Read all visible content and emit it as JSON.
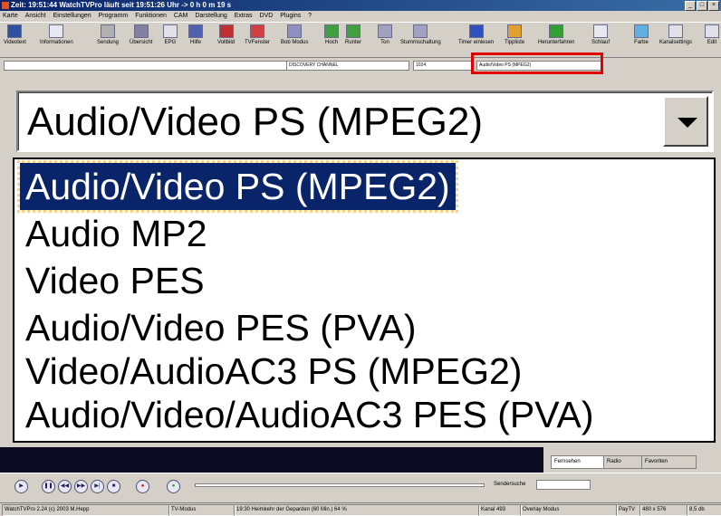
{
  "window": {
    "title": "Zeit: 19:51:44 WatchTVPro läuft seit 19:51:26 Uhr -> 0 h 0 m 19 s",
    "controls": [
      "_",
      "□",
      "×"
    ]
  },
  "menu": [
    "Karte",
    "Ansicht",
    "Einstellungen",
    "Programm",
    "Funktionen",
    "CAM",
    "Darstellung",
    "Extras",
    "DVD",
    "Plugins",
    "?"
  ],
  "toolbar": [
    {
      "label": "Videotext",
      "icon": "videotext-icon"
    },
    {
      "label": "Informationen",
      "icon": "info-icon"
    },
    {
      "label": "Sendung",
      "icon": "program-icon"
    },
    {
      "label": "Übersicht",
      "icon": "overview-icon"
    },
    {
      "label": "EPG",
      "icon": "epg-icon"
    },
    {
      "label": "Hilfe",
      "icon": "help-icon"
    },
    {
      "label": "Vollbild",
      "icon": "fullscreen-icon"
    },
    {
      "label": "TVFenster",
      "icon": "tv-window-icon"
    },
    {
      "label": "Bob Modus",
      "icon": "bob-mode-icon"
    },
    {
      "label": "Hoch",
      "icon": "up-icon"
    },
    {
      "label": "Runter",
      "icon": "down-icon"
    },
    {
      "label": "Ton",
      "icon": "sound-icon"
    },
    {
      "label": "Stummschaltung",
      "icon": "mute-icon"
    },
    {
      "label": "Timer einlesen",
      "icon": "timer-icon"
    },
    {
      "label": "Tippliste",
      "icon": "list-icon"
    },
    {
      "label": "Herunterfahren",
      "icon": "shutdown-icon"
    },
    {
      "label": "Schlauf",
      "icon": "sleep-icon"
    },
    {
      "label": "Farbe",
      "icon": "color-icon"
    },
    {
      "label": "Kanalsettings",
      "icon": "channel-settings-icon"
    },
    {
      "label": "Edit",
      "icon": "edit-icon"
    }
  ],
  "combobar": {
    "channel": "DISCOVERY CHANNEL",
    "code": "1024",
    "format": "Audio/Video PS (MPEG2)"
  },
  "format_select": {
    "selected": "Audio/Video PS (MPEG2)",
    "options": [
      "Audio/Video PS (MPEG2)",
      "Audio MP2",
      "Video PES",
      "Audio/Video PES (PVA)",
      "Video/AudioAC3 PS (MPEG2)",
      "Audio/Video/AudioAC3 PES (PVA)"
    ]
  },
  "tabs": [
    "Fernsehen",
    "Radio",
    "Favoriten"
  ],
  "search": {
    "label": "Sendersuche",
    "value": ""
  },
  "statusbar": [
    "WatchTVPro 2.24 (c) 2003 M.Hepp",
    "TV-Modus",
    "19:30 Heimkehr der Geparden (60 Min.) 64 %",
    "Kanal 493",
    "Overlay Modus",
    "PayTV",
    "480 x 576",
    "8,5 db"
  ],
  "colors": {
    "selection": "#0a246a",
    "highlight_frame": "#e00000",
    "face": "#d4d0c8"
  }
}
